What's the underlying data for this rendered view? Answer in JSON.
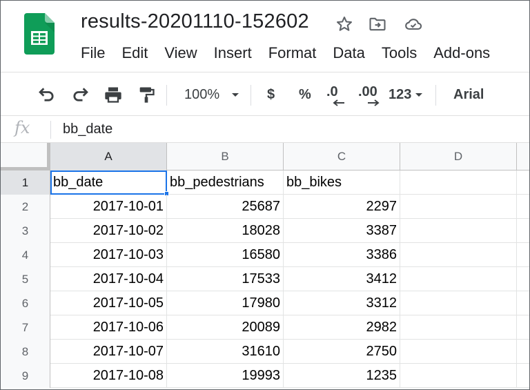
{
  "app": {
    "doc_title": "results-20201110-152602",
    "menus": [
      "File",
      "Edit",
      "View",
      "Insert",
      "Format",
      "Data",
      "Tools",
      "Add-ons"
    ]
  },
  "toolbar": {
    "zoom": "100%",
    "currency": "$",
    "percent": "%",
    "decrease_decimals": ".0",
    "increase_decimals": ".00",
    "more_formats": "123",
    "font": "Arial"
  },
  "formula_bar": {
    "fx_label": "fx",
    "value": "bb_date"
  },
  "grid": {
    "columns": [
      "A",
      "B",
      "C",
      "D"
    ],
    "rows": [
      {
        "num": "1",
        "cells": [
          "bb_date",
          "bb_pedestrians",
          "bb_bikes",
          ""
        ]
      },
      {
        "num": "2",
        "cells": [
          "2017-10-01",
          "25687",
          "2297",
          ""
        ]
      },
      {
        "num": "3",
        "cells": [
          "2017-10-02",
          "18028",
          "3387",
          ""
        ]
      },
      {
        "num": "4",
        "cells": [
          "2017-10-03",
          "16580",
          "3386",
          ""
        ]
      },
      {
        "num": "5",
        "cells": [
          "2017-10-04",
          "17533",
          "3412",
          ""
        ]
      },
      {
        "num": "6",
        "cells": [
          "2017-10-05",
          "17980",
          "3312",
          ""
        ]
      },
      {
        "num": "7",
        "cells": [
          "2017-10-06",
          "20089",
          "2982",
          ""
        ]
      },
      {
        "num": "8",
        "cells": [
          "2017-10-07",
          "31610",
          "2750",
          ""
        ]
      },
      {
        "num": "9",
        "cells": [
          "2017-10-08",
          "19993",
          "1235",
          ""
        ]
      }
    ]
  },
  "colors": {
    "logo_green": "#0f9d58",
    "selection_blue": "#1a73e8"
  }
}
